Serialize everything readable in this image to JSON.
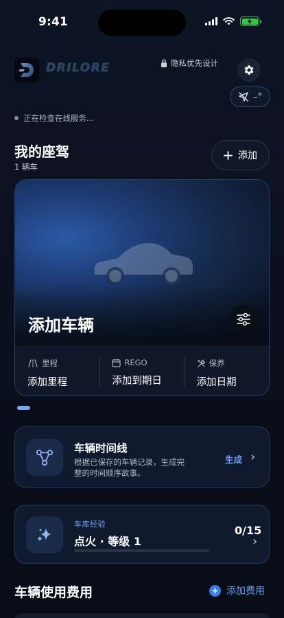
{
  "status_bar": {
    "time": "9:41"
  },
  "header": {
    "logo_text": "DRILORE",
    "privacy_label": "隐私优先设计",
    "weather_value": "–°"
  },
  "online_status": "正在检查在线服务...",
  "my_vehicles": {
    "title": "我的座驾",
    "count_label": "1 辆车",
    "add_label": "添加"
  },
  "vehicle_card": {
    "name": "添加车辆",
    "stats": [
      {
        "label": "里程",
        "value": "添加里程"
      },
      {
        "label": "REGO",
        "value": "添加到期日"
      },
      {
        "label": "保养",
        "value": "添加日期"
      }
    ]
  },
  "timeline": {
    "title": "车辆时间线",
    "description": "根据已保存的车辆记录，生成完整的时间顺序故事。",
    "action_label": "生成"
  },
  "garage": {
    "kicker": "车库经验",
    "level_label": "点火 · 等级 1",
    "progress_text": "0/15",
    "progress_fraction": 0
  },
  "costs": {
    "title": "车辆使用费用",
    "add_label": "添加费用"
  },
  "colors": {
    "accent": "#6ea2f0",
    "card_border": "#243a60",
    "background": "#0a0f1c",
    "battery": "#3ec14a"
  },
  "icons": [
    "lock-icon",
    "gear-icon",
    "location-off-icon",
    "plus-icon",
    "car-icon",
    "sliders-icon",
    "road-icon",
    "calendar-icon",
    "tools-icon",
    "timeline-icon",
    "sparkle-icon",
    "chevron-right-icon"
  ]
}
